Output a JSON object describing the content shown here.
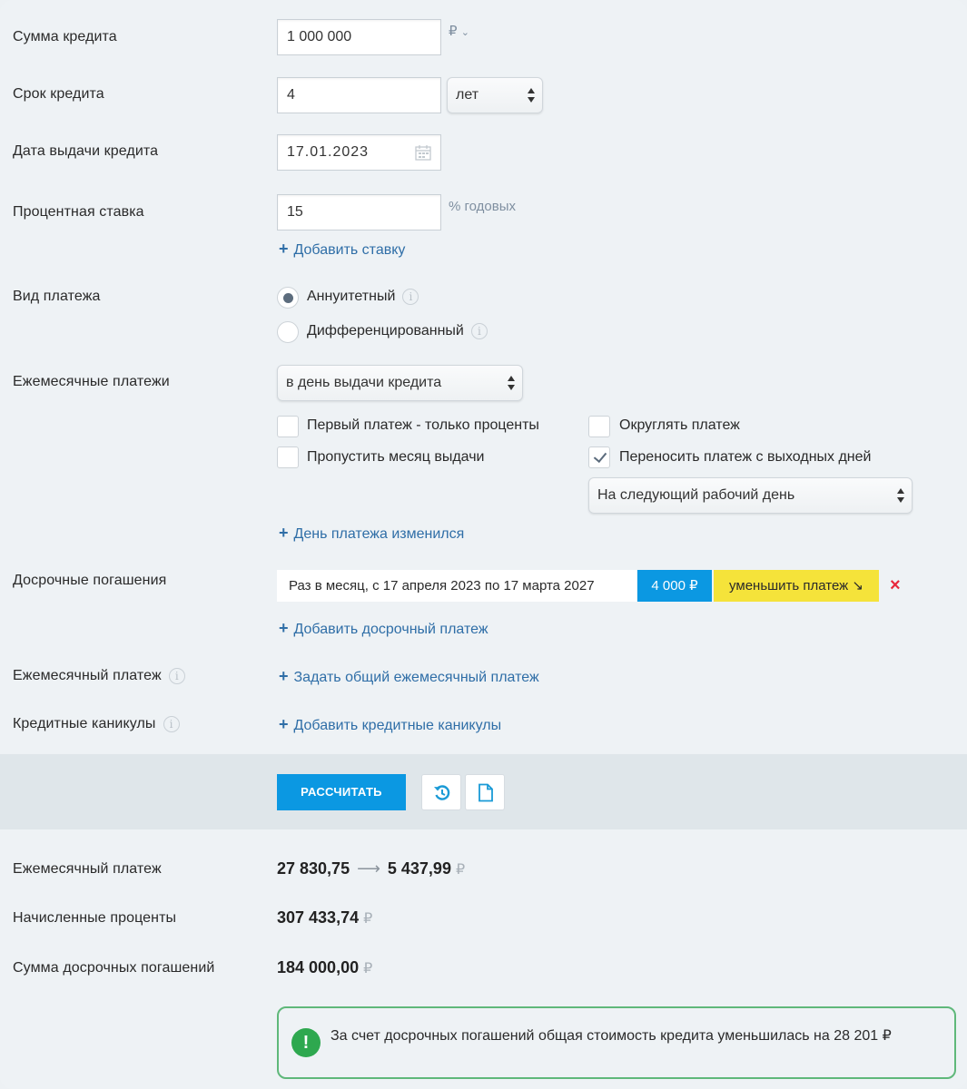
{
  "form": {
    "loan_amount": {
      "label": "Сумма кредита",
      "value": "1 000 000",
      "currency": "₽"
    },
    "loan_term": {
      "label": "Срок кредита",
      "value": "4",
      "unit": "лет"
    },
    "issue_date": {
      "label": "Дата выдачи кредита",
      "value": "17.01.2023"
    },
    "rate": {
      "label": "Процентная ставка",
      "value": "15",
      "unit": "% годовых",
      "add_link": "Добавить ставку"
    },
    "payment_type": {
      "label": "Вид платежа",
      "options": [
        {
          "label": "Аннуитетный",
          "selected": true
        },
        {
          "label": "Дифференцированный",
          "selected": false
        }
      ]
    },
    "monthly_payments": {
      "label": "Ежемесячные платежи",
      "select_value": "в день выдачи кредита",
      "checkboxes": [
        {
          "label": "Первый платеж - только проценты",
          "checked": false
        },
        {
          "label": "Пропустить месяц выдачи",
          "checked": false
        },
        {
          "label": "Округлять платеж",
          "checked": false
        },
        {
          "label": "Переносить платеж с выходных дней",
          "checked": true
        }
      ],
      "transfer_select": "На следующий рабочий день",
      "day_changed_link": "День платежа изменился"
    },
    "early_repayments": {
      "label": "Досрочные погашения",
      "item": {
        "period": "Раз в месяц, с 17 апреля 2023 по 17 марта 2027",
        "amount": "4 000 ₽",
        "mode": "уменьшить платеж ↘",
        "remove": "×"
      },
      "add_link": "Добавить досрочный платеж"
    },
    "monthly_payment": {
      "label": "Ежемесячный платеж",
      "link": "Задать общий ежемесячный платеж"
    },
    "credit_holidays": {
      "label": "Кредитные каникулы",
      "link": "Добавить кредитные каникулы"
    }
  },
  "actions": {
    "calculate": "РАССЧИТАТЬ",
    "reset_icon": "reset-icon",
    "document_icon": "document-icon"
  },
  "results": {
    "monthly_payment": {
      "label": "Ежемесячный платеж",
      "from": "27 830,75",
      "to": "5 437,99",
      "currency": "₽"
    },
    "interest": {
      "label": "Начисленные проценты",
      "value": "307 433,74",
      "currency": "₽"
    },
    "early_sum": {
      "label": "Сумма досрочных погашений",
      "value": "184 000,00",
      "currency": "₽"
    },
    "note": {
      "icon": "!",
      "text": "За счет досрочных погашений общая стоимость кредита уменьшилась на 28 201 ₽"
    }
  },
  "colors": {
    "accent": "#0b98e2",
    "link": "#2f6ea7",
    "badge_amount": "#0b98e2",
    "badge_mode": "#f5e33a",
    "success": "#2ea84f",
    "remove": "#e8283c"
  }
}
